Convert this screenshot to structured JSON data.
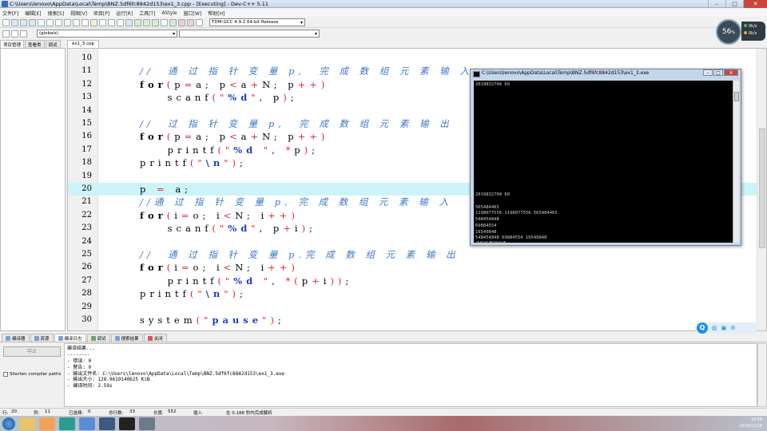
{
  "window": {
    "title": "C:\\Users\\lenovo\\AppData\\Local\\Temp\\BNZ.5df6fc8842d153\\ex1_3.cpp - [Executing] - Dev-C++ 5.11"
  },
  "menu": [
    "文件[F]",
    "编辑[E]",
    "搜索[S]",
    "视图[V]",
    "项目[P]",
    "运行[R]",
    "工具[T]",
    "AStyle",
    "窗口[W]",
    "帮助[H]"
  ],
  "toolbar": {
    "compiler": "TDM-GCC 4.9.2 64-bit Release",
    "scope": "(globals)"
  },
  "monitor": {
    "cpu": "56",
    "unit": "%",
    "up": "0k/s",
    "down": "0k/s"
  },
  "left_tabs": [
    "项目管理",
    "查看类",
    "调试"
  ],
  "file_tab": "ex1_3.cpp",
  "code_lines": [
    {
      "n": "10",
      "html": ""
    },
    {
      "n": "11",
      "html": "<span class='cm'>//  通 过 指 针 变 量 p,  完 成 数 组 元 素 输 入</span>"
    },
    {
      "n": "12",
      "html": "<span class='kw'>for</span><span class='op'>(</span>p<span class='op'>=</span>a; p<span class='op'>&lt;</span>a<span class='op'>+</span>N; p<span class='op'>++)</span>"
    },
    {
      "n": "13",
      "html": "    scanf<span class='op'>(</span><span class='str'>\"</span><span class='fmt'>%d</span><span class='str'>\"</span>, p<span class='op'>)</span>;"
    },
    {
      "n": "14",
      "html": ""
    },
    {
      "n": "15",
      "html": "<span class='cm'>//  过 指 针 变 量 p,  完 成 数 组 元 素 输 出</span>"
    },
    {
      "n": "16",
      "html": "<span class='kw'>for</span><span class='op'>(</span>p<span class='op'>=</span>a; p<span class='op'>&lt;</span>a<span class='op'>+</span>N; p<span class='op'>++)</span>"
    },
    {
      "n": "17",
      "html": "    printf<span class='op'>(</span><span class='str'>\"</span><span class='fmt'>%d</span> <span class='str'>\"</span>, <span class='op'>*</span>p<span class='op'>)</span>;"
    },
    {
      "n": "18",
      "html": "printf<span class='op'>(</span><span class='str'>\"</span><span class='fmt'>\\n</span><span class='str'>\"</span><span class='op'>)</span>;"
    },
    {
      "n": "19",
      "html": ""
    },
    {
      "n": "20",
      "html": "p <span class='op'>=</span> a;",
      "hl": true
    },
    {
      "n": "21",
      "html": "<span class='cm'>//通 过 指 针 变 量 p, 完 成 数 组 元 素 输 入</span>"
    },
    {
      "n": "22",
      "html": "<span class='kw'>for</span><span class='op'>(</span>i<span class='op'>=</span>o; i<span class='op'>&lt;</span>N; i<span class='op'>++)</span>"
    },
    {
      "n": "23",
      "html": "    scanf<span class='op'>(</span><span class='str'>\"</span><span class='fmt'>%d</span><span class='str'>\"</span>, p<span class='op'>+</span>i<span class='op'>)</span>;"
    },
    {
      "n": "24",
      "html": ""
    },
    {
      "n": "25",
      "html": "<span class='cm'>//  通 过 指 针 变 量 p.完 成 数 组 元 素 输 出</span>"
    },
    {
      "n": "26",
      "html": "<span class='kw'>for</span><span class='op'>(</span>i<span class='op'>=</span>o; i<span class='op'>&lt;</span>N; i<span class='op'>++)</span>"
    },
    {
      "n": "27",
      "html": "    printf<span class='op'>(</span><span class='str'>\"</span><span class='fmt'>%d</span> <span class='str'>\"</span>, <span class='op'>*(</span>p<span class='op'>+</span>i<span class='op'>))</span>;"
    },
    {
      "n": "28",
      "html": "printf<span class='op'>(</span><span class='str'>\"</span><span class='fmt'>\\n</span><span class='str'>\"</span><span class='op'>)</span>;"
    },
    {
      "n": "29",
      "html": ""
    },
    {
      "n": "30",
      "html": "system<span class='op'>(</span><span class='str'>\"</span><span class='fmt'>pause</span><span class='str'>\"</span><span class='op'>)</span>;"
    }
  ],
  "console": {
    "title": "C:\\Users\\lenovo\\AppData\\Local\\Temp\\BNZ.5df6fc8842d153\\ex1_3.exe",
    "lines": [
      "2019832704 60",
      "",
      "",
      "",
      "",
      "",
      "",
      "",
      "",
      "",
      "",
      "",
      "",
      "",
      "",
      "",
      "",
      "",
      "2019832704 60",
      "",
      "565484465",
      "1198077556 1198077556 565484465",
      "548454848",
      "69884554",
      "16549848",
      "548454848 69884554 16549848",
      "请按任意键继续. . . _"
    ]
  },
  "bottom_tabs": [
    "编译器",
    "资源",
    "编译日志",
    "调试",
    "搜索结果",
    "关闭"
  ],
  "stop_label": "中止",
  "shorten_label": "Shorten compiler paths",
  "log": [
    "编译结果...",
    "--------",
    "- 错误: 0",
    "- 警告: 0",
    "- 输出文件名: C:\\Users\\lenovo\\AppData\\Local\\Temp\\BNZ.5df6fc8842d153\\ex1_3.exe",
    "- 输出大小: 128.9619140625 KiB",
    "- 编译时间: 2.59s"
  ],
  "status": {
    "row_label": "行:",
    "row": "20",
    "col_label": "列:",
    "col": "11",
    "sel_label": "已选择:",
    "sel": "0",
    "total_label": "总行数:",
    "total": "33",
    "len_label": "长度:",
    "len": "552",
    "mode": "插入",
    "parse": "在 0.188 秒内完成解析"
  },
  "clock": {
    "time": "18:58",
    "date": "2019/12/16"
  }
}
